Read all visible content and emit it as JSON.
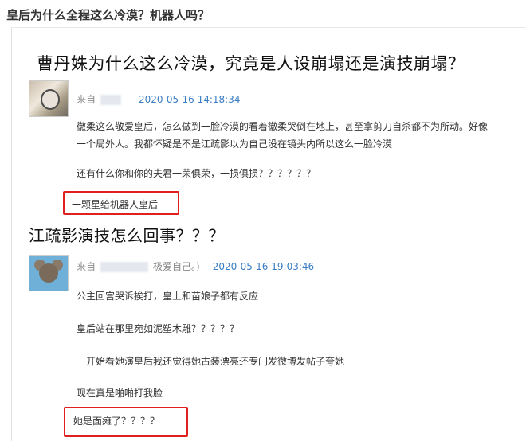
{
  "page": {
    "title": "皇后为什么全程这么冷漠？机器人吗？"
  },
  "section1": {
    "heading": "曹丹姝为什么这么冷漠，究竟是人设崩塌还是演技崩塌？",
    "comment": {
      "from_label": "来自",
      "datetime": "2020-05-16 14:18:34",
      "lines": [
        "徽柔这么敬爱皇后，怎么做到一脸冷漠的看着徽柔哭倒在地上，甚至拿剪刀自杀都不为所动。好像",
        "一个局外人。我都怀疑是不是江疏影以为自己没在镜头内所以这么一脸冷漠",
        "还有什么你和你的夫君一荣俱荣，一损俱损？？？？？？",
        "一颗星给机器人皇后"
      ]
    }
  },
  "section2": {
    "heading": "江疏影演技怎么回事？？？",
    "comment": {
      "from_label": "来自",
      "name_suffix": "极爱自己。)",
      "datetime": "2020-05-16 19:03:46",
      "lines": [
        "公主回宫哭诉挨打，皇上和苗娘子都有反应",
        "皇后站在那里宛如泥塑木雕？？？？？",
        "一开始看她演皇后我还觉得她古装漂亮还专门发微博发帖子夸她",
        "现在真是啪啪打我脸",
        "她是面瘫了？？？？"
      ]
    }
  },
  "colors": {
    "highlight": "#e02020",
    "date": "#3b7dc4"
  }
}
